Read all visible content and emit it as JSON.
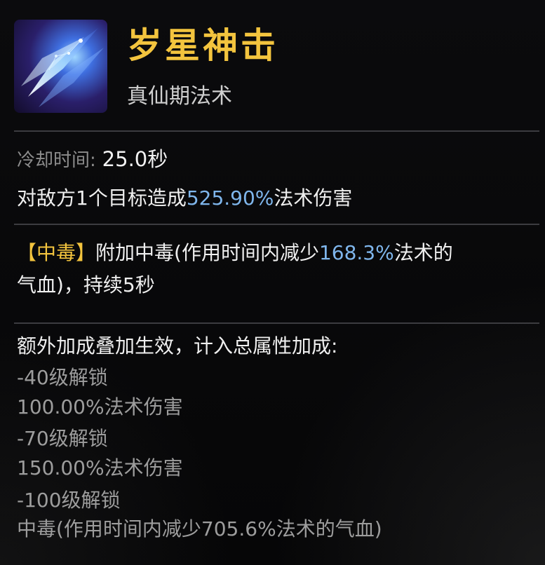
{
  "skill": {
    "title": "岁星神击",
    "subtitle": "真仙期法术",
    "icon": "crystal-strike-icon"
  },
  "stats": {
    "cooldown_label": "冷却时间:",
    "cooldown_value": "25.0秒"
  },
  "description": {
    "prefix": "对敌方1个目标造成",
    "value": "525.90%",
    "suffix": "法术伤害"
  },
  "effect": {
    "tag": "【中毒】",
    "text_a": "附加中毒(作用时间内减少",
    "value": "168.3%",
    "text_b": "法术的",
    "text_c": "气血)，持续5秒"
  },
  "bonus": {
    "header": "额外加成叠加生效，计入总属性加成:",
    "items": [
      "-40级解锁",
      "100.00%法术伤害",
      "-70级解锁",
      "150.00%法术伤害",
      "-100级解锁",
      "中毒(作用时间内减少705.6%法术的气血)"
    ]
  },
  "colors": {
    "title": "#f3c43e",
    "highlight": "#7fb6ec",
    "tag": "#f3c43e"
  }
}
